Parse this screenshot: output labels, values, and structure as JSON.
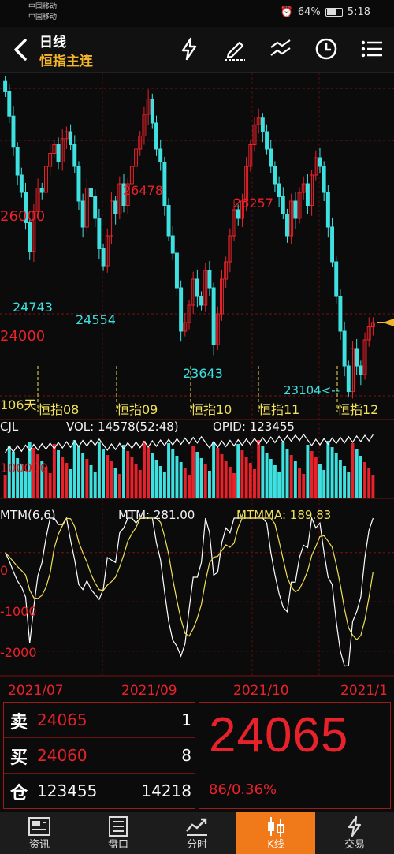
{
  "status_bar": {
    "carrier1": "中国移动",
    "carrier2": "中国移动",
    "battery": "64%",
    "time": "5:18"
  },
  "header": {
    "title": "日线",
    "subtitle": "恒指主连",
    "icons": [
      "flash-icon",
      "draw-icon",
      "trend-lines-icon",
      "clock-icon",
      "list-icon"
    ]
  },
  "chart": {
    "price_levels": [
      "26000",
      "24000"
    ],
    "annotations": {
      "high1": "26478",
      "high2": "26257",
      "low1": "24743",
      "low2": "24554",
      "low3": "23643",
      "low4": "23104<--",
      "days": "106天"
    },
    "contracts": [
      "恒指08",
      "恒指09",
      "恒指10",
      "恒指11",
      "恒指12"
    ],
    "cjl": {
      "label": "CJL",
      "vol_text": "VOL: 14578(52:48)",
      "opid_text": "OPID: 123455",
      "axis_label": "100000"
    },
    "mtm": {
      "label": "MTM(6,6)",
      "mtm_text": "MTM: 281.00",
      "mtmma_text": "MTMMA: 189.83",
      "axis": [
        "0",
        "-1000",
        "-2000"
      ]
    },
    "dates": [
      "2021/07",
      "2021/09",
      "2021/10",
      "2021/1"
    ],
    "colors": {
      "up": "#e8222a",
      "down": "#3ee0e0",
      "mtm": "#ffffff",
      "mtmma": "#f0e05a",
      "current_arrow": "#f5b52a"
    }
  },
  "chart_data": {
    "type": "candlestick",
    "title": "恒指主连",
    "closes": [
      26560,
      26280,
      25920,
      25600,
      25400,
      25050,
      24720,
      25180,
      25450,
      25400,
      25700,
      25850,
      25950,
      25750,
      26020,
      26100,
      25950,
      25700,
      25300,
      25000,
      25450,
      25350,
      25100,
      24750,
      24554,
      24900,
      25300,
      25150,
      25500,
      25250,
      25500,
      25700,
      25900,
      26050,
      26300,
      26478,
      26200,
      25900,
      25750,
      25250,
      24900,
      24700,
      24300,
      23800,
      23900,
      24100,
      24400,
      24200,
      24100,
      24500,
      24300,
      23643,
      24000,
      24400,
      24600,
      24900,
      25200,
      25100,
      25300,
      25700,
      25950,
      26180,
      26257,
      26100,
      25900,
      25700,
      25500,
      25350,
      25150,
      24900,
      25300,
      25100,
      25400,
      25500,
      25250,
      25600,
      25800,
      25700,
      25400,
      25000,
      24600,
      24200,
      23800,
      23400,
      23104,
      23600,
      23400,
      23300,
      23700,
      23850,
      23900
    ],
    "y_min": 23100,
    "y_max": 26600,
    "levels": [
      26000,
      24000
    ],
    "mtm_range": [
      -2500,
      700
    ]
  },
  "quote": {
    "sell_label": "卖",
    "sell_price": "24065",
    "sell_volume": "1",
    "buy_label": "买",
    "buy_price": "24060",
    "buy_volume": "8",
    "oi_label": "仓",
    "open_interest": "123455",
    "volume": "14218",
    "last_price": "24065",
    "change": "86/0.36%"
  },
  "bottom_nav": [
    {
      "label": "资讯"
    },
    {
      "label": "盘口"
    },
    {
      "label": "分时"
    },
    {
      "label": "K线"
    },
    {
      "label": "交易"
    }
  ]
}
